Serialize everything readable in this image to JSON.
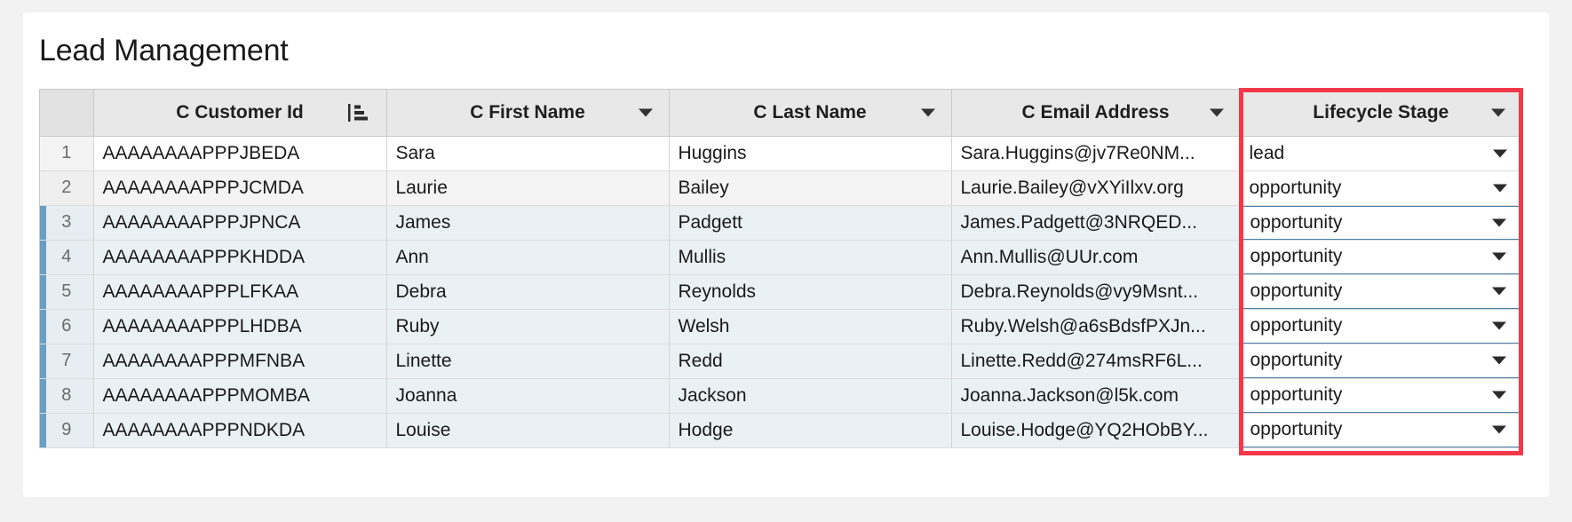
{
  "page": {
    "title": "Lead Management",
    "accent_red": "#f4384a",
    "selection_blue": "#6b9ec1",
    "focus_border": "#4a7fa5",
    "header_bg": "#e8e8e8"
  },
  "grid": {
    "columns": [
      {
        "key": "row_number",
        "label": "",
        "icon": "none"
      },
      {
        "key": "customer_id",
        "label": "C Customer Id",
        "icon": "sort-ascending-icon"
      },
      {
        "key": "first_name",
        "label": "C First Name",
        "icon": "chevron-down-icon"
      },
      {
        "key": "last_name",
        "label": "C Last Name",
        "icon": "chevron-down-icon"
      },
      {
        "key": "email_address",
        "label": "C Email Address",
        "icon": "chevron-down-icon"
      },
      {
        "key": "lifecycle_stage",
        "label": "Lifecycle Stage",
        "icon": "chevron-down-icon"
      }
    ],
    "rows": [
      {
        "row_number": "1",
        "customer_id": "AAAAAAAAPPPJBEDA",
        "first_name": "Sara",
        "last_name": "Huggins",
        "email_address": "Sara.Huggins@jv7Re0NM...",
        "lifecycle_stage": "lead",
        "selected": false,
        "focused": false
      },
      {
        "row_number": "2",
        "customer_id": "AAAAAAAAPPPJCMDA",
        "first_name": "Laurie",
        "last_name": "Bailey",
        "email_address": "Laurie.Bailey@vXYiIlxv.org",
        "lifecycle_stage": "opportunity",
        "selected": false,
        "focused": false
      },
      {
        "row_number": "3",
        "customer_id": "AAAAAAAAPPPJPNCA",
        "first_name": "James",
        "last_name": "Padgett",
        "email_address": "James.Padgett@3NRQED...",
        "lifecycle_stage": "opportunity",
        "selected": true,
        "focused": true
      },
      {
        "row_number": "4",
        "customer_id": "AAAAAAAAPPPKHDDA",
        "first_name": "Ann",
        "last_name": "Mullis",
        "email_address": "Ann.Mullis@UUr.com",
        "lifecycle_stage": "opportunity",
        "selected": true,
        "focused": true
      },
      {
        "row_number": "5",
        "customer_id": "AAAAAAAAPPPLFKAA",
        "first_name": "Debra",
        "last_name": "Reynolds",
        "email_address": "Debra.Reynolds@vy9Msnt...",
        "lifecycle_stage": "opportunity",
        "selected": true,
        "focused": true
      },
      {
        "row_number": "6",
        "customer_id": "AAAAAAAAPPPLHDBA",
        "first_name": "Ruby",
        "last_name": "Welsh",
        "email_address": "Ruby.Welsh@a6sBdsfPXJn...",
        "lifecycle_stage": "opportunity",
        "selected": true,
        "focused": true
      },
      {
        "row_number": "7",
        "customer_id": "AAAAAAAAPPPMFNBA",
        "first_name": "Linette",
        "last_name": "Redd",
        "email_address": "Linette.Redd@274msRF6L...",
        "lifecycle_stage": "opportunity",
        "selected": true,
        "focused": true
      },
      {
        "row_number": "8",
        "customer_id": "AAAAAAAAPPPMOMBA",
        "first_name": "Joanna",
        "last_name": "Jackson",
        "email_address": "Joanna.Jackson@l5k.com",
        "lifecycle_stage": "opportunity",
        "selected": true,
        "focused": true
      },
      {
        "row_number": "9",
        "customer_id": "AAAAAAAAPPPNDKDA",
        "first_name": "Louise",
        "last_name": "Hodge",
        "email_address": "Louise.Hodge@YQ2HObBY...",
        "lifecycle_stage": "opportunity",
        "selected": true,
        "focused": true
      }
    ]
  },
  "annotation": {
    "highlighted_column": "Lifecycle Stage",
    "color": "#f4384a"
  }
}
